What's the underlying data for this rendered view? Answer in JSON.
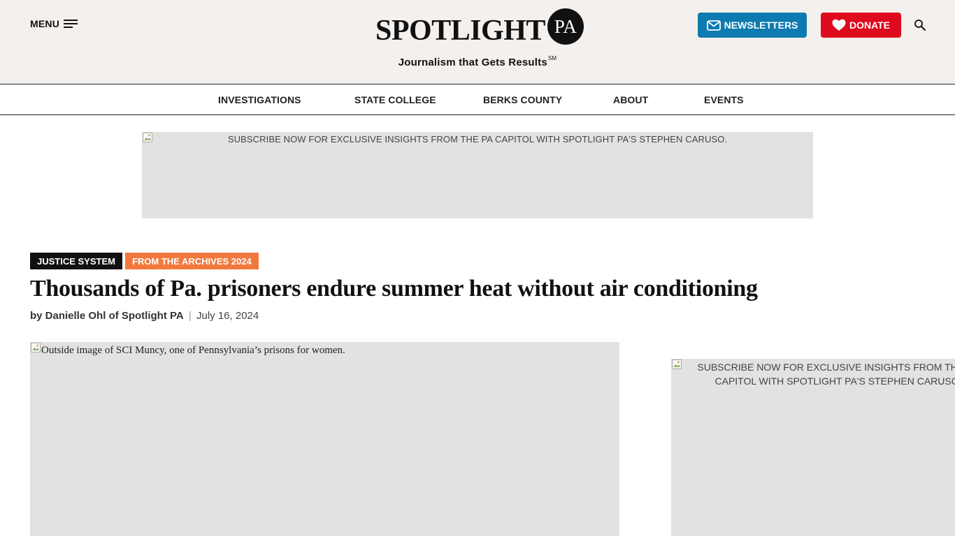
{
  "header": {
    "menu_label": "MENU",
    "logo_word": "SPOTLIGHT",
    "logo_badge": "PA",
    "tagline": "Journalism that Gets Results",
    "tagline_mark": "SM",
    "newsletters_label": "NEWSLETTERS",
    "donate_label": "DONATE",
    "colors": {
      "background": "#f4f0ed",
      "newsletters": "#0d7bb0",
      "donate": "#e00a1e"
    }
  },
  "nav": {
    "items": [
      {
        "label": "INVESTIGATIONS"
      },
      {
        "label": "STATE COLLEGE"
      },
      {
        "label": "BERKS COUNTY"
      },
      {
        "label": "ABOUT"
      },
      {
        "label": "EVENTS"
      }
    ]
  },
  "ads": {
    "top_alt": "SUBSCRIBE NOW FOR EXCLUSIVE INSIGHTS FROM THE PA CAPITOL WITH SPOTLIGHT PA'S STEPHEN CARUSO.",
    "side_alt": "SUBSCRIBE NOW FOR EXCLUSIVE INSIGHTS FROM THE PA CAPITOL WITH SPOTLIGHT PA'S STEPHEN CARUSO."
  },
  "article": {
    "tags": [
      {
        "label": "JUSTICE SYSTEM",
        "color": "#111111"
      },
      {
        "label": "FROM THE ARCHIVES 2024",
        "color": "#f2783d"
      }
    ],
    "headline": "Thousands of Pa. prisoners endure summer heat without air conditioning",
    "author": "by Danielle Ohl of Spotlight PA",
    "separator": "|",
    "date": "July 16, 2024",
    "hero_alt": "Outside image of SCI Muncy, one of Pennsylvania’s prisons for women."
  }
}
